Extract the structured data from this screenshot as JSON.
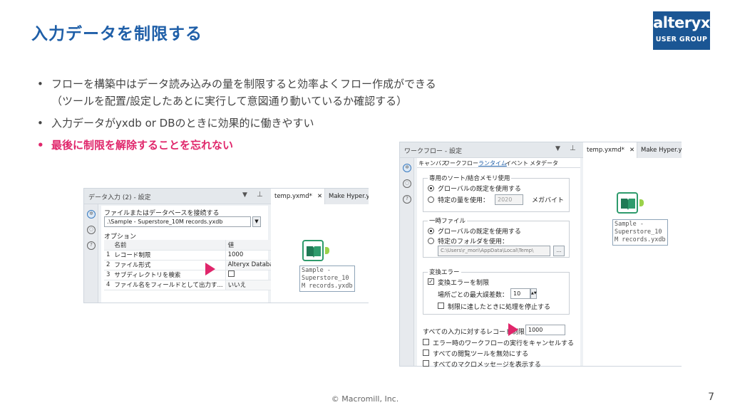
{
  "slide": {
    "title": "入力データを制限する",
    "bullets": [
      {
        "line1": "フローを構築中はデータ読み込みの量を制限すると効率よくフロー作成ができる",
        "line2": "（ツールを配置/設定したあとに実行して意図通り動いているか確認する）"
      },
      {
        "line1": "入力データがyxdb or DBのときに効果的に働きやすい"
      },
      {
        "line1": "最後に制限を解除することを忘れない"
      }
    ],
    "logo": {
      "line1": "alteryx",
      "line2": "USER GROUP"
    },
    "footer": "© Macromill, Inc.",
    "page_number": "7",
    "colors": {
      "title": "#1f5fa8",
      "emphasis": "#e0266b",
      "logo_bg": "#1b5694"
    }
  },
  "panel1": {
    "header": "データ入力 (2) - 設定",
    "file_label": "ファイルまたはデータベースを接続する",
    "file_value": ".\\Sample - Superstore_10M records.yxdb",
    "options_label": "オプション",
    "table": {
      "headers": [
        "名前",
        "値"
      ],
      "rows": [
        {
          "num": "1",
          "name": "レコード制限",
          "value": "1000"
        },
        {
          "num": "2",
          "name": "ファイル形式",
          "value": "Alteryx Database"
        },
        {
          "num": "3",
          "name": "サブディレクトリを検索",
          "value": ""
        },
        {
          "num": "4",
          "name": "ファイル名をフィールドとして出力す...",
          "value": "いいえ"
        }
      ]
    },
    "tabs": [
      {
        "label": "temp.yxmd*"
      },
      {
        "label": "Make Hyper.yx"
      }
    ],
    "tab_close": "✕",
    "node_label": "Sample -\nSuperstore_10\nM records.yxdb"
  },
  "panel2": {
    "header": "ワークフロー - 設定",
    "subtabs": [
      "キャンバス",
      "ワークフロー",
      "ランタイム",
      "イベント",
      "メタデータ"
    ],
    "memory_group": "専用のソート/結合メモリ使用",
    "memory_opt1": "グローバルの既定を使用する",
    "memory_opt2": "特定の量を使用：",
    "memory_value": "2020",
    "memory_unit": "メガバイト",
    "temp_group": "一時ファイル",
    "temp_opt1": "グローバルの既定を使用する",
    "temp_opt2": "特定のフォルダを使用：",
    "temp_path": "C:\\Users\\r_mori\\AppData\\Local\\Temp\\",
    "browse": "...",
    "error_group": "変換エラー",
    "error_limit": "変換エラーを制限",
    "error_max_label": "場所ごとの最大誤差数：",
    "error_max_value": "10",
    "error_stop": "制限に達したときに処理を停止する",
    "record_limit_label": "すべての入力に対するレコード制限",
    "record_limit_value": "1000",
    "cancel_on_error": "エラー時のワークフローの実行をキャンセルする",
    "disable_browse": "すべての閲覧ツールを無効にする",
    "show_macro_msgs": "すべてのマクロメッセージを表示する",
    "tabs": [
      {
        "label": "temp.yxmd*"
      },
      {
        "label": "Make Hyper.yx"
      }
    ],
    "tab_close": "✕",
    "node_label": "Sample -\nSuperstore_10\nM records.yxdb"
  },
  "icons": [
    "gear-icon",
    "pin-icon",
    "chevron-down-icon",
    "input-data-book-icon",
    "arrow-marker-icon"
  ]
}
